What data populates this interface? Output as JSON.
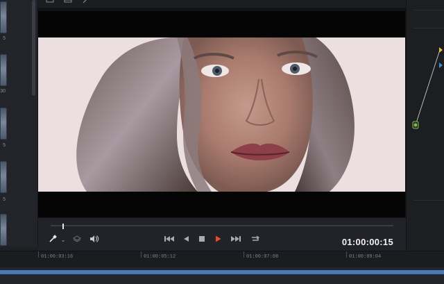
{
  "viewer": {
    "timecode": "01:00:00:15",
    "playhead_position_fraction": 0.034
  },
  "toolbar": {
    "icons": [
      "clip-icon",
      "list-icon",
      "magic-wand-icon"
    ]
  },
  "media_pool": {
    "labels": [
      "5",
      "30",
      "5",
      "5"
    ]
  },
  "transport": {
    "buttons": [
      "eyedropper-icon",
      "chevron-down-icon",
      "layers-icon",
      "volume-icon",
      "skip-back-icon",
      "step-back-icon",
      "stop-icon",
      "play-icon",
      "skip-forward-icon",
      "loop-icon"
    ]
  },
  "timeline": {
    "ticks": [
      "01:00:03:16",
      "01:00:05:12",
      "01:00:07:08",
      "01:00:09:04"
    ]
  },
  "colors": {
    "play_accent": "#e84a2f",
    "clip_blue": "#4a78b5"
  }
}
